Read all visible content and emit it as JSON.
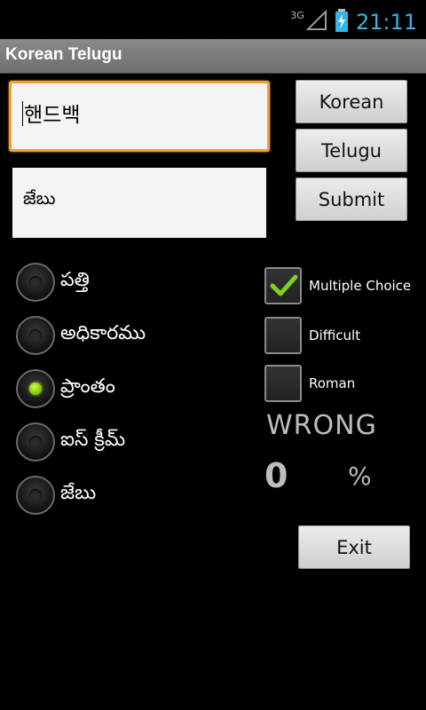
{
  "status": {
    "network": "3G",
    "time": "21:11"
  },
  "app": {
    "title": "Korean Telugu"
  },
  "question": {
    "value": "핸드백"
  },
  "answer": {
    "value": "జేబు"
  },
  "buttons": {
    "korean": "Korean",
    "telugu": "Telugu",
    "submit": "Submit",
    "exit": "Exit"
  },
  "choices": [
    {
      "label": "పత్తి",
      "selected": false
    },
    {
      "label": "అధికారము",
      "selected": false
    },
    {
      "label": "ప్రాంతం",
      "selected": true
    },
    {
      "label": "ఐస్ క్రీమ్",
      "selected": false
    },
    {
      "label": "జేబు",
      "selected": false
    }
  ],
  "options": [
    {
      "label": "Multiple Choice",
      "checked": true
    },
    {
      "label": "Difficult",
      "checked": false
    },
    {
      "label": "Roman",
      "checked": false
    }
  ],
  "result": {
    "status": "WRONG",
    "score": "0",
    "unit": "%"
  },
  "colors": {
    "accent": "#f2a02a",
    "radio_on": "#9cf000",
    "check": "#7fd11b",
    "clock": "#33b5e5"
  }
}
